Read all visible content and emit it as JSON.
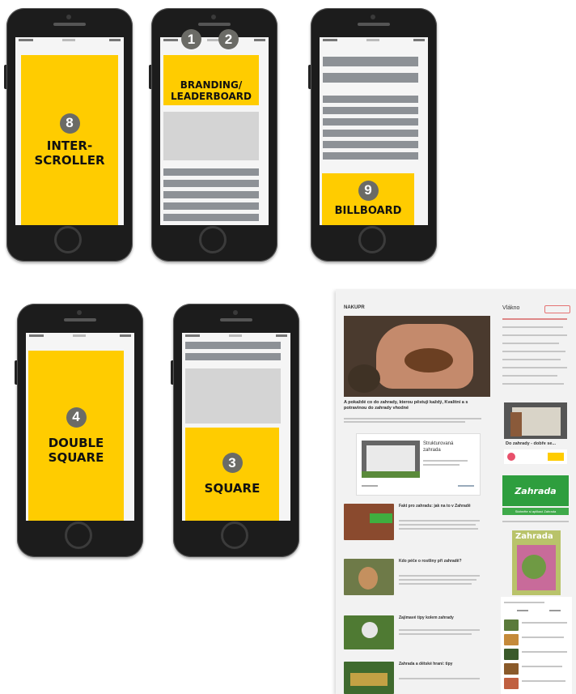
{
  "phones": [
    {
      "number": "8",
      "label_line1": "INTER-",
      "label_line2": "SCROLLER"
    },
    {
      "number_a": "1",
      "number_b": "2",
      "label_line1": "BRANDING/",
      "label_line2": "LEADERBOARD"
    },
    {
      "number": "9",
      "label_line1": "BILLBOARD"
    },
    {
      "number": "4",
      "label_line1": "DOUBLE",
      "label_line2": "SQUARE"
    },
    {
      "number": "3",
      "label_line1": "SQUARE"
    }
  ],
  "colors": {
    "ad_yellow": "#ffcc00",
    "badge_gray": "#6b6b66",
    "bar_gray": "#8d9196",
    "green": "#2e9e3e"
  },
  "website": {
    "section": "NAKUPR",
    "sidebar_title": "Vlákno",
    "headline": "A pokaždé co do zahrady, kterou pěstuji každý, Kvalitní a s potravinou do zahrady vhodné",
    "ad_title": "Strukturovaná zahrada",
    "promo_title": "Do zahrady - dobře se...",
    "brand": "Zahrada",
    "brand_cta": "Stáhněte si aplikaci Zahrada",
    "magazine_title": "Zahrada",
    "articles": [
      "Fakt pro zahradu: jak na to v Zahradě",
      "Kdo péče o rostliny při zahradě?",
      "Zajímavé tipy kolem zahrady",
      "Zahrada a dětské hraní: tipy"
    ]
  }
}
